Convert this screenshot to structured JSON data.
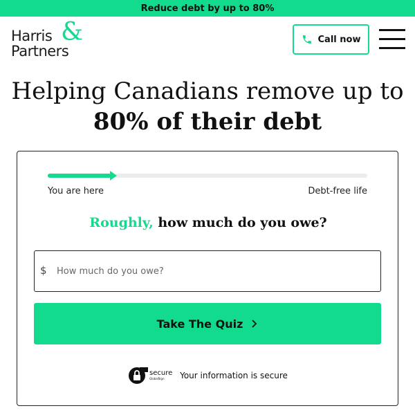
{
  "banner": {
    "text": "Reduce debt by up to 80%"
  },
  "header": {
    "logo": {
      "line1": "Harris",
      "amp": "&",
      "line2": "Partners"
    },
    "call_button": {
      "label": "Call now",
      "icon": "phone-icon"
    },
    "menu": {
      "icon": "hamburger-menu-icon"
    }
  },
  "headline": {
    "line1": "Helping Canadians remove up to",
    "line2": "80% of their debt"
  },
  "quiz_card": {
    "progress": {
      "value": 0.2,
      "start_label": "You are here",
      "end_label": "Debt-free life"
    },
    "question": {
      "accent": "Roughly,",
      "rest": " how much do you owe?"
    },
    "amount_input": {
      "prefix": "$",
      "placeholder": "How much do you owe?",
      "value": ""
    },
    "submit_button": {
      "label": "Take The Quiz",
      "icon": "chevron-right-icon"
    },
    "security": {
      "badge_text": "secure",
      "badge_subtext": "GlobalSign",
      "text": "Your information is secure"
    }
  },
  "colors": {
    "accent": "#12db8e",
    "text": "#111111",
    "border": "#222222"
  }
}
